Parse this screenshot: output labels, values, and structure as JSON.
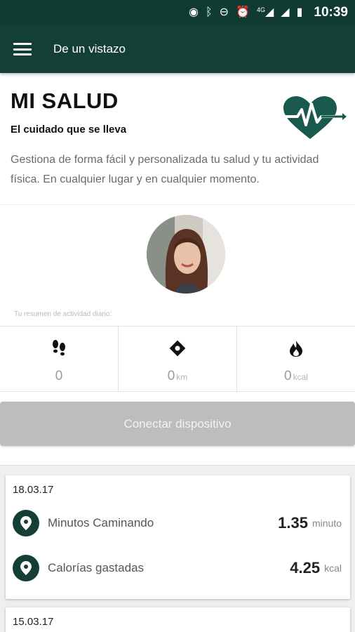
{
  "status_bar": {
    "time": "10:39",
    "network": "4G",
    "icons": [
      "hotspot-icon",
      "bluetooth-icon",
      "dnd-icon",
      "alarm-icon",
      "signal-icon",
      "battery-icon"
    ]
  },
  "app_bar": {
    "title": "De un vistazo",
    "menu_icon": "hamburger-icon"
  },
  "hero": {
    "title": "MI SALUD",
    "subtitle": "El cuidado que se lleva",
    "description": "Gestiona de forma fácil y personalizada tu salud y tu actividad física. En cualquier lugar y en cualquier momento.",
    "icon": "heart-pulse-icon"
  },
  "profile": {
    "summary_label": "Tu resumen de actividad diario:"
  },
  "stats": [
    {
      "icon": "footsteps-icon",
      "value": "0",
      "unit": ""
    },
    {
      "icon": "location-diamond-icon",
      "value": "0",
      "unit": "km"
    },
    {
      "icon": "flame-icon",
      "value": "0",
      "unit": "kcal"
    }
  ],
  "connect_button": {
    "label": "Conectar dispositivo"
  },
  "feed": [
    {
      "date": "18.03.17",
      "rows": [
        {
          "label": "Minutos Caminando",
          "value": "1.35",
          "unit": "minuto"
        },
        {
          "label": "Calorías gastadas",
          "value": "4.25",
          "unit": "kcal"
        }
      ]
    },
    {
      "date": "15.03.17",
      "rows": []
    }
  ],
  "colors": {
    "primary": "#143f37",
    "status_bar": "#0f3b33",
    "disabled_button": "#bdbdbd"
  }
}
